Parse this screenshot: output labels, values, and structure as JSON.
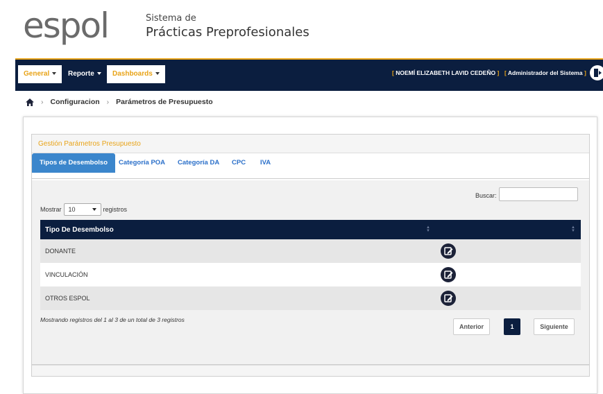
{
  "brand": {
    "logo_text": "espol",
    "system_sub": "Sistema de",
    "system_main": "Prácticas Preprofesionales"
  },
  "navbar": {
    "menus": [
      {
        "label": "General"
      },
      {
        "label": "Reporte"
      },
      {
        "label": "Dashboards"
      }
    ],
    "user_name": "NOEMÍ ELIZABETH LAVID CEDEÑO",
    "user_role": "Administrador del Sistema"
  },
  "breadcrumb": {
    "items": [
      "Configuracion",
      "Parámetros de Presupuesto"
    ]
  },
  "panel": {
    "title": "Gestión Parámetros Presupuesto",
    "tabs": [
      "Tipos de Desembolso",
      "Categoría POA",
      "Categoría DA",
      "CPC",
      "IVA"
    ],
    "active_tab": "Tipos de Desembolso"
  },
  "table_controls": {
    "search_label": "Buscar:",
    "show_prefix": "Mostrar",
    "page_size": "10",
    "show_suffix": "registros"
  },
  "table": {
    "column": "Tipo De Desembolso",
    "rows": [
      "DONANTE",
      "VINCULACIÓN",
      "OTROS ESPOL"
    ]
  },
  "pagination": {
    "info": "Mostrando registros del 1 al 3 de un total de 3 registros",
    "prev": "Anterior",
    "current": "1",
    "next": "Siguiente"
  },
  "colors": {
    "navy": "#0b1e3f",
    "accent": "#e8a317",
    "tab_active": "#3b86cc"
  }
}
